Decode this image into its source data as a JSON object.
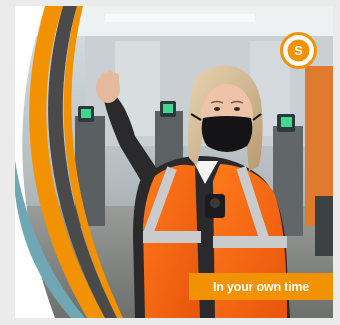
{
  "card": {
    "caption": "In your own time",
    "photo_description_icon": "staff-photo",
    "logo": {
      "letter": "S",
      "icon": "brand-logo-icon",
      "color": "#f39200"
    }
  },
  "colors": {
    "accent_orange": "#f39200",
    "accent_dark_grey": "#4a4a4a",
    "accent_teal": "#6fa8b4",
    "background": "#ebebeb"
  }
}
